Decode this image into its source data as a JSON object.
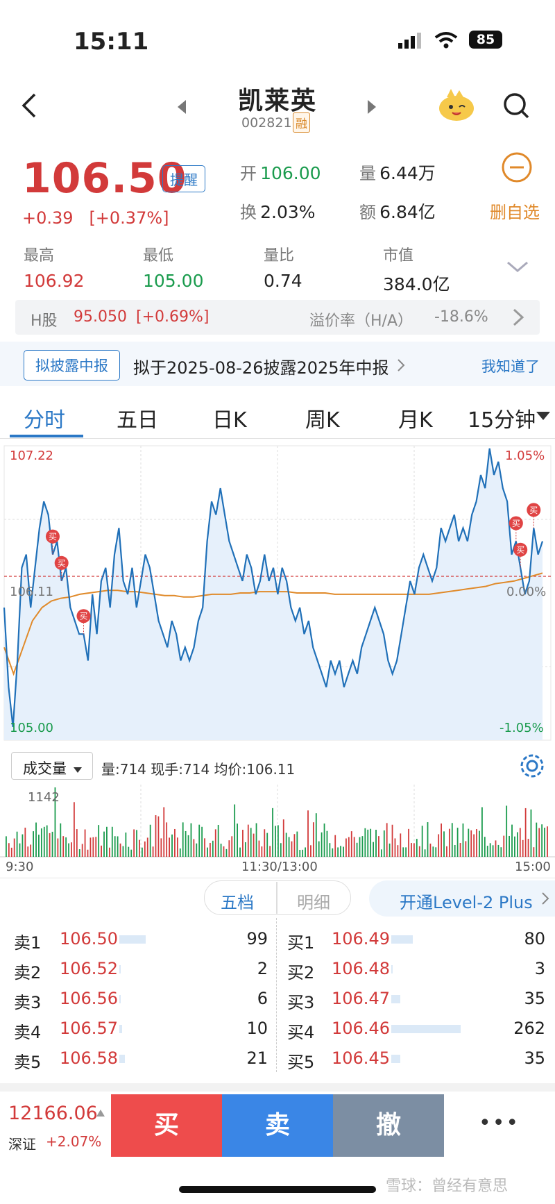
{
  "status_bar": {
    "time": "15:11",
    "battery": "85"
  },
  "nav": {
    "title": "凯莱英",
    "code": "002821",
    "rong": "融"
  },
  "quote": {
    "price": "106.50",
    "remind": "提醒",
    "change": "+0.39",
    "change_pct": "[+0.37%]",
    "open_label": "开",
    "open": "106.00",
    "volume_label": "量",
    "volume": "6.44万",
    "turnover_label": "换",
    "turnover": "2.03%",
    "amount_label": "额",
    "amount": "6.84亿",
    "watch_label": "删自选",
    "high_label": "最高",
    "high": "106.92",
    "low_label": "最低",
    "low": "105.00",
    "vol_ratio_label": "量比",
    "vol_ratio": "0.74",
    "mktcap_label": "市值",
    "mktcap": "384.0亿"
  },
  "hshare": {
    "label": "H股",
    "price": "95.050",
    "change": "[+0.69%]",
    "premium_label": "溢价率（H/A）",
    "premium": "-18.6%"
  },
  "banner": {
    "tag": "拟披露中报",
    "text": "拟于2025-08-26披露2025年中报",
    "ack": "我知道了"
  },
  "tabs": [
    "分时",
    "五日",
    "日K",
    "周K",
    "月K",
    "15分钟"
  ],
  "chart_labels": {
    "top_left": "107.22",
    "top_right": "1.05%",
    "mid_left": "106.11",
    "mid_right": "0.00%",
    "bottom_left": "105.00",
    "bottom_right": "-1.05%",
    "buy": "买"
  },
  "volume_panel": {
    "selector": "成交量",
    "info": "量:714  现手:714  均价:106.11",
    "max_label": "1142",
    "time_start": "9:30",
    "time_mid": "11:30/13:00",
    "time_end": "15:00"
  },
  "orderbook_tabs": {
    "five": "五档",
    "detail": "明细",
    "level2": "开通Level-2 Plus"
  },
  "orderbook": {
    "sells": [
      {
        "label": "卖1",
        "price": "106.50",
        "qty": "99",
        "frac": 0.38
      },
      {
        "label": "卖2",
        "price": "106.52",
        "qty": "2",
        "frac": 0.01
      },
      {
        "label": "卖3",
        "price": "106.56",
        "qty": "6",
        "frac": 0.02
      },
      {
        "label": "卖4",
        "price": "106.57",
        "qty": "10",
        "frac": 0.04
      },
      {
        "label": "卖5",
        "price": "106.58",
        "qty": "21",
        "frac": 0.08
      }
    ],
    "buys": [
      {
        "label": "买1",
        "price": "106.49",
        "qty": "80",
        "frac": 0.31
      },
      {
        "label": "买2",
        "price": "106.48",
        "qty": "3",
        "frac": 0.01
      },
      {
        "label": "买3",
        "price": "106.47",
        "qty": "35",
        "frac": 0.13
      },
      {
        "label": "买4",
        "price": "106.46",
        "qty": "262",
        "frac": 1.0
      },
      {
        "label": "买5",
        "price": "106.45",
        "qty": "35",
        "frac": 0.13
      }
    ]
  },
  "index": {
    "value": "12166.06",
    "name": "深证",
    "pct": "+2.07%"
  },
  "actions": {
    "buy": "买",
    "sell": "卖",
    "cancel": "撤",
    "more": "•••"
  },
  "watermark": "雪球：曾经有意思",
  "colors": {
    "up": "#d23a3a",
    "down": "#1a9b4d",
    "accent": "#2b78c6",
    "line": "#2070b8",
    "avg": "#e08a2a"
  },
  "chart_data": {
    "type": "line",
    "y_range": [
      105.0,
      107.22
    ],
    "prev_close": 106.11,
    "x_label_start": "9:30",
    "x_label_mid": "11:30/13:00",
    "x_label_end": "15:00",
    "series": [
      {
        "values": [
          106.0,
          105.4,
          105.1,
          105.6,
          106.3,
          106.4,
          106.0,
          106.3,
          106.6,
          106.8,
          106.7,
          106.4,
          106.5,
          106.2,
          106.3,
          106.0,
          105.9,
          105.8,
          105.8,
          105.6,
          106.1,
          105.8,
          106.2,
          106.3,
          106.0,
          106.4,
          106.6,
          106.2,
          106.1,
          106.3,
          106.0,
          106.2,
          106.4,
          106.3,
          106.1,
          105.9,
          105.8,
          105.7,
          105.9,
          105.8,
          105.6,
          105.7,
          105.6,
          105.7,
          105.9,
          106.0,
          106.5,
          106.8,
          106.7,
          106.9,
          106.7,
          106.5,
          106.4,
          106.3,
          106.2,
          106.4,
          106.3,
          106.1,
          106.2,
          106.4,
          106.2,
          106.3,
          106.1,
          106.3,
          106.2,
          106.0,
          105.9,
          106.0,
          105.8,
          105.9,
          105.7,
          105.6,
          105.5,
          105.4,
          105.6,
          105.5,
          105.6,
          105.4,
          105.5,
          105.6,
          105.5,
          105.7,
          105.8,
          105.9,
          106.0,
          105.9,
          105.8,
          105.6,
          105.5,
          105.6,
          105.8,
          106.0,
          106.2,
          106.1,
          106.3,
          106.4,
          106.3,
          106.2,
          106.3,
          106.6,
          106.5,
          106.6,
          106.7,
          106.5,
          106.6,
          106.5,
          106.7,
          106.8,
          107.0,
          106.9,
          107.2,
          107.0,
          107.1,
          106.9,
          106.8,
          106.4,
          106.5,
          106.3,
          106.1,
          106.2,
          106.6,
          106.4,
          106.5
        ],
        "name": ""
      },
      {
        "values": [
          105.7,
          105.5,
          105.7,
          105.9,
          106.0,
          106.05,
          106.07,
          106.08,
          106.1,
          106.11,
          106.12,
          106.13,
          106.13,
          106.12,
          106.12,
          106.11,
          106.1,
          106.09,
          106.09,
          106.08,
          106.08,
          106.09,
          106.1,
          106.1,
          106.1,
          106.11,
          106.11,
          106.12,
          106.12,
          106.12,
          106.12,
          106.11,
          106.11,
          106.11,
          106.11,
          106.1,
          106.1,
          106.1,
          106.1,
          106.1,
          106.1,
          106.1,
          106.1,
          106.1,
          106.1,
          106.1,
          106.11,
          106.12,
          106.13,
          106.14,
          106.15,
          106.16,
          106.18,
          106.19,
          106.2,
          106.22,
          106.24,
          106.26
        ],
        "name": ""
      }
    ]
  }
}
